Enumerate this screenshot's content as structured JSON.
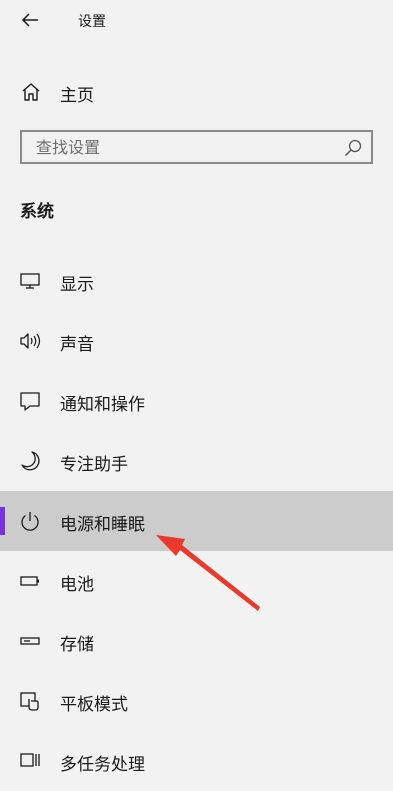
{
  "window": {
    "title": "设置"
  },
  "home": {
    "label": "主页"
  },
  "search": {
    "placeholder": "查找设置",
    "value": ""
  },
  "section_title": "系统",
  "nav": {
    "items": [
      {
        "label": "显示",
        "icon": "monitor-icon"
      },
      {
        "label": "声音",
        "icon": "speaker-icon"
      },
      {
        "label": "通知和操作",
        "icon": "notification-icon"
      },
      {
        "label": "专注助手",
        "icon": "moon-icon"
      },
      {
        "label": "电源和睡眠",
        "icon": "power-icon",
        "selected": true
      },
      {
        "label": "电池",
        "icon": "battery-icon"
      },
      {
        "label": "存储",
        "icon": "storage-icon"
      },
      {
        "label": "平板模式",
        "icon": "tablet-mode-icon"
      },
      {
        "label": "多任务处理",
        "icon": "multitasking-icon"
      }
    ]
  },
  "colors": {
    "background": "#f2f2f2",
    "selected_background": "#cccccc",
    "accent": "#7b2fe0",
    "annotation_arrow": "#e8392a"
  }
}
